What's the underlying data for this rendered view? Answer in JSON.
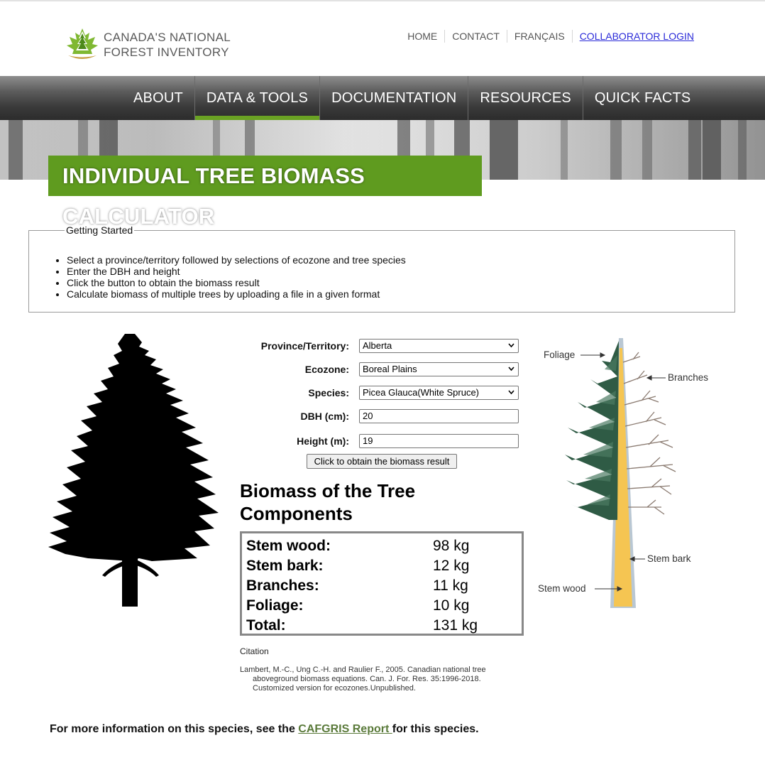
{
  "header": {
    "logo_line1": "CANADA'S NATIONAL",
    "logo_line2": "FOREST INVENTORY",
    "utility_links": [
      "HOME",
      "CONTACT",
      "FRANÇAIS",
      "COLLABORATOR LOGIN"
    ]
  },
  "nav": {
    "items": [
      "ABOUT",
      "DATA & TOOLS",
      "DOCUMENTATION",
      "RESOURCES",
      "QUICK FACTS"
    ],
    "active": "DATA & TOOLS"
  },
  "page_title": "INDIVIDUAL TREE BIOMASS CALCULATOR",
  "getting_started": {
    "legend": "Getting Started",
    "items": [
      "Select a province/territory followed by selections of ecozone and tree species",
      "Enter the DBH and height",
      "Click the button to obtain the biomass result",
      "Calculate biomass of multiple trees by uploading a file in a given format"
    ]
  },
  "form": {
    "province_label": "Province/Territory:",
    "province_value": "Alberta",
    "ecozone_label": "Ecozone:",
    "ecozone_value": "Boreal Plains",
    "species_label": "Species:",
    "species_value": "Picea Glauca(White Spruce)",
    "dbh_label": "DBH (cm):",
    "dbh_value": "20",
    "height_label": "Height (m):",
    "height_value": "19",
    "button_label": "Click to obtain the biomass result"
  },
  "results": {
    "title": "Biomass of the Tree Components",
    "rows": [
      {
        "label": "Stem wood:",
        "value": "98 kg"
      },
      {
        "label": "Stem bark:",
        "value": "12 kg"
      },
      {
        "label": "Branches:",
        "value": "11 kg"
      },
      {
        "label": "Foliage:",
        "value": "10 kg"
      },
      {
        "label": "Total:",
        "value": "131 kg"
      }
    ]
  },
  "citation": {
    "label": "Citation",
    "text": "Lambert, M.-C., Ung C.-H. and Raulier F., 2005. Canadian national tree aboveground biomass equations. Can. J. For. Res. 35:1996-2018. Customized version for ecozones.Unpublished."
  },
  "diagram_labels": {
    "foliage": "Foliage",
    "branches": "Branches",
    "stem_bark": "Stem bark",
    "stem_wood": "Stem wood"
  },
  "footer": {
    "prefix": "For more information on this species, see the ",
    "link": "CAFGRIS Report ",
    "suffix": "for this species."
  },
  "colors": {
    "brand_green": "#5f9b1f",
    "nav_active": "#6aa223",
    "login_link": "#2a2ad8"
  }
}
